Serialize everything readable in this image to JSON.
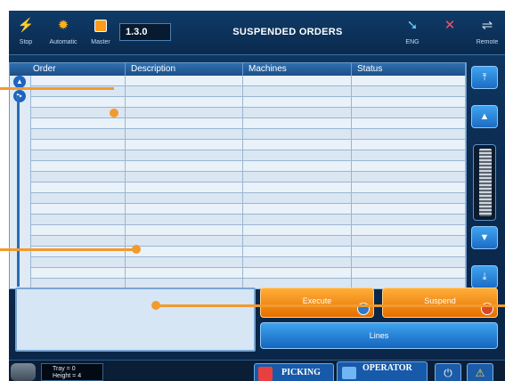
{
  "toolbar": {
    "stop_label": "Stop",
    "automatic_label": "Automatic",
    "master_label": "Master",
    "version": "1.3.0",
    "title": "SUSPENDED ORDERS",
    "eng_label": "ENG",
    "remote_label": "Remote"
  },
  "table": {
    "columns": [
      "Order",
      "Description",
      "Machines",
      "Status"
    ],
    "row_count": 20
  },
  "buttons": {
    "execute": "Execute",
    "suspend": "Suspend",
    "lines": "Lines"
  },
  "statusbar": {
    "tray": "Tray = 0",
    "height": "Height = 4",
    "picking": "PICKING",
    "operator": "OPERATOR"
  },
  "icons": {
    "stop": "lightning-icon",
    "automatic": "gear-icon",
    "master": "master-icon",
    "eng": "language-icon",
    "remote": "remote-icon"
  },
  "colors": {
    "accent_orange": "#f39a2c",
    "button_orange": "#e46f00",
    "button_blue": "#1565bf",
    "background_blue": "#0b2c52"
  }
}
